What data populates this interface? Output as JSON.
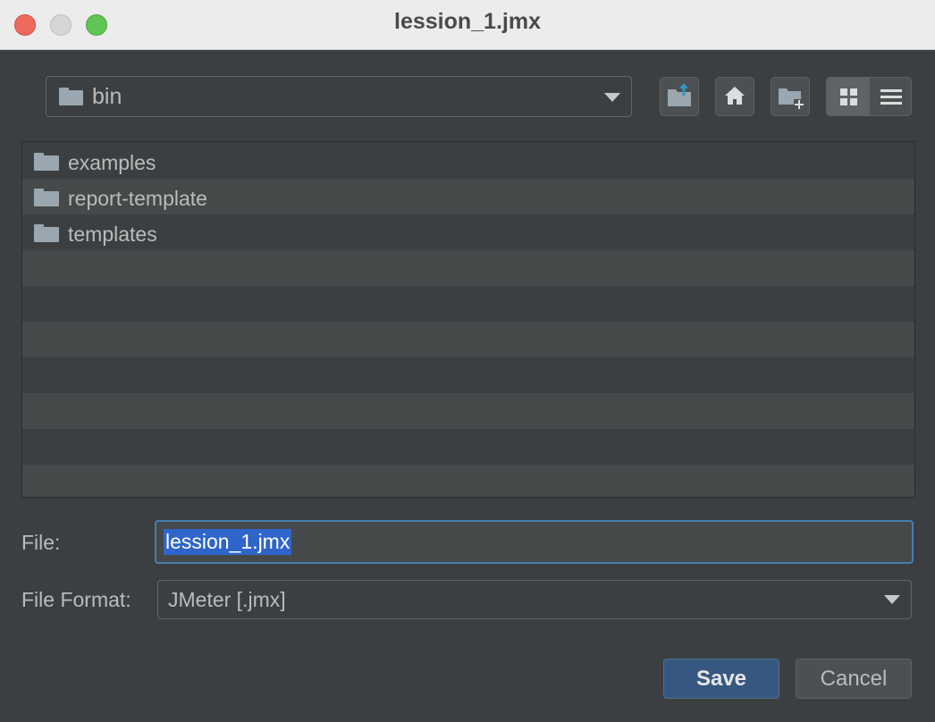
{
  "window": {
    "title": "lession_1.jmx"
  },
  "toolbar": {
    "path": {
      "folder_icon": "folder-icon",
      "value": "bin"
    },
    "buttons": [
      {
        "icon": "up-folder-icon"
      },
      {
        "icon": "home-icon"
      },
      {
        "icon": "new-folder-icon"
      }
    ],
    "view_toggle": {
      "selected": "grid",
      "options": [
        "grid-view-icon",
        "list-view-icon"
      ]
    }
  },
  "file_list": {
    "items": [
      {
        "name": "examples",
        "icon": "folder-icon"
      },
      {
        "name": "report-template",
        "icon": "folder-icon"
      },
      {
        "name": "templates",
        "icon": "folder-icon"
      }
    ]
  },
  "form": {
    "file_label": "File:",
    "file_value": "lession_1.jmx",
    "format_label": "File Format:",
    "format_value": "JMeter [.jmx]"
  },
  "actions": {
    "save_label": "Save",
    "cancel_label": "Cancel"
  },
  "colors": {
    "accent": "#365880",
    "selection": "#2f65ca",
    "background": "#3c3f41"
  }
}
